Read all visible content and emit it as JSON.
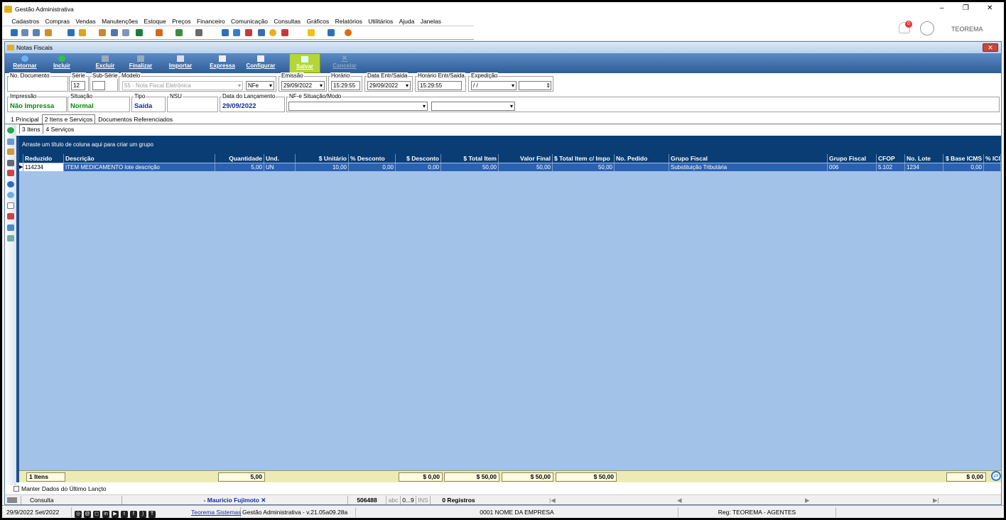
{
  "window": {
    "title": "Gestão Administrativa",
    "minimize": "–",
    "restore": "❐",
    "close": "✕"
  },
  "menu": [
    "Cadastros",
    "Compras",
    "Vendas",
    "Manutenções",
    "Estoque",
    "Preços",
    "Financeiro",
    "Comunicação",
    "Consultas",
    "Gráficos",
    "Relatórios",
    "Utilitários",
    "Ajuda",
    "Janelas"
  ],
  "topright": {
    "notifications": "0",
    "company": "TEOREMA"
  },
  "form": {
    "title": "Notas Fiscais"
  },
  "toolbar": {
    "retornar": "Retornar",
    "incluir": "Incluir",
    "excluir": "Excluir",
    "finalizar": "Finalizar",
    "importar": "Importar",
    "expressa": "Expressa",
    "configurar": "Configurar",
    "salvar": "Salvar",
    "cancelar": "Cancelar"
  },
  "fields": {
    "no_documento": {
      "label": "No. Documento",
      "value": ""
    },
    "serie": {
      "label": "Série",
      "value": "12"
    },
    "sub_serie": {
      "label": "Sub-Série",
      "value": ""
    },
    "modelo": {
      "label": "Modelo",
      "value": "55 - Nota Fiscal Eletrônica",
      "tipo": "NFe"
    },
    "emissao": {
      "label": "Emissão",
      "value": "29/09/2022"
    },
    "horario": {
      "label": "Horário",
      "value": "15:29:55"
    },
    "data_entr": {
      "label": "Data Entr/Saida",
      "value": "29/09/2022"
    },
    "horario_entr": {
      "label": "Horário Entr/Saida",
      "value": "15:29:55"
    },
    "expedicao": {
      "label": "Expedição",
      "value": " / /"
    },
    "impressao": {
      "label": "Impressão",
      "value": "Não Impressa"
    },
    "situacao": {
      "label": "Situação",
      "value": "Normal"
    },
    "tipo": {
      "label": "Tipo",
      "value": "Saída"
    },
    "nsu": {
      "label": "NSU",
      "value": ""
    },
    "data_lanc": {
      "label": "Data do Lançamento",
      "value": "29/09/2022"
    },
    "nfe_situacao": {
      "label": "NF-e Situação/Modo",
      "value": ""
    }
  },
  "tabs": [
    "1 Principal",
    "2 Itens e Serviços",
    "Documentos Referenciados"
  ],
  "subtabs": [
    "3 Itens",
    "4 Serviços"
  ],
  "grid": {
    "group_hint": "Arraste um título de coluna aqui para criar um grupo",
    "columns": [
      "Reduzido",
      "Descrição",
      "Quantidade",
      "Und.",
      "$ Unitário",
      "% Desconto",
      "$ Desconto",
      "$ Total Item",
      "Valor Final",
      "$ Total Item c/ Impo",
      "No. Pedido",
      "Grupo Fiscal",
      "Grupo Fiscal",
      "CFOP",
      "No. Lote",
      "$ Base ICMS",
      "% ICI"
    ],
    "rows": [
      [
        "114234",
        "ITEM MEDICAMENTO lote descrição",
        "5,00",
        "UN",
        "10,00",
        "0,00",
        "0,00",
        "50,00",
        "50,00",
        "50,00",
        "",
        "Substituição Tributária",
        "006",
        "5.102",
        "1234",
        "0,00",
        ""
      ]
    ],
    "footer": {
      "count": "1 Itens",
      "quantidade": "5,00",
      "desconto": "$ 0,00",
      "total_item": "$ 50,00",
      "valor_final": "$ 50,00",
      "total_impo": "$ 50,00",
      "base_icms": "$ 0,00"
    }
  },
  "manter": "Manter Dados do Último Lançto",
  "status": {
    "mode": "Consulta",
    "user": "- Mauricio Fujimoto ✕",
    "code": "506488",
    "abc": "abc",
    "range": "0...9",
    "ins": "INS",
    "registros": "0 Registros"
  },
  "bottom": {
    "date": "29/9/2022 Set/2022",
    "link": "Teorema Sistemas",
    "app": "Gestão Administrativa - v.21.05a09.28a",
    "empresa": "0001 NOME DA EMPRESA",
    "reg": "Reg: TEOREMA - AGENTES"
  }
}
